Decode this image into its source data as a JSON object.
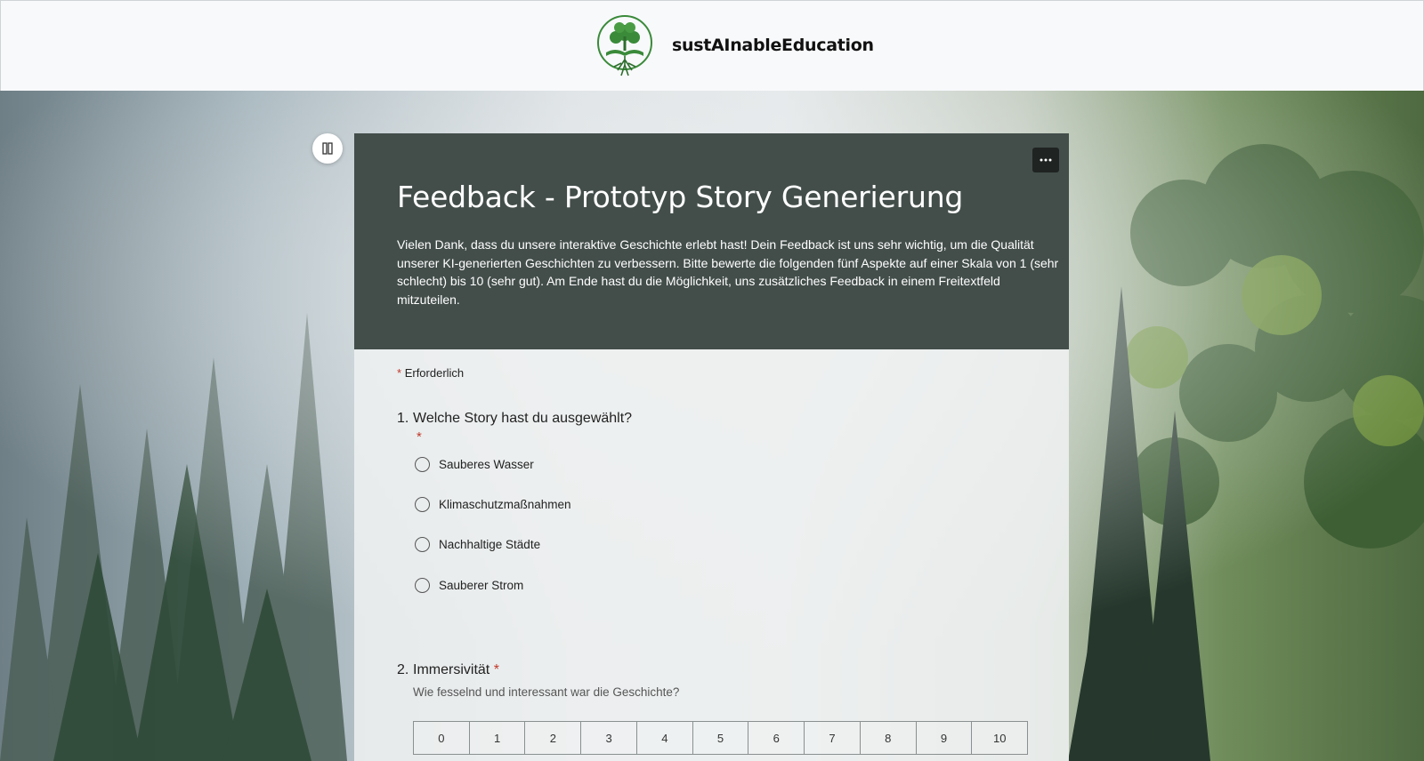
{
  "header": {
    "brand_name": "sustAInableEducation",
    "logo_icon": "tree-book-logo"
  },
  "colors": {
    "form_header_bg": "#434e4b",
    "required_star": "#c0392b",
    "brand_green": "#3a8a3a"
  },
  "controls": {
    "pause_icon": "pause-icon",
    "more_icon": "more-options-icon"
  },
  "form": {
    "title": "Feedback - Prototyp Story Generierung",
    "description": "Vielen Dank, dass du unsere interaktive Geschichte erlebt hast! Dein Feedback ist uns sehr wichtig, um die Qualität unserer KI-generierten Geschichten zu verbessern. Bitte bewerte die folgenden fünf Aspekte auf einer Skala von 1 (sehr schlecht) bis 10 (sehr gut). Am Ende hast du die Möglichkeit, uns zusätzliches Feedback in einem Freitextfeld mitzuteilen.",
    "required_star": "*",
    "required_label": "Erforderlich"
  },
  "questions": [
    {
      "number": "1.",
      "title": "Welche Story hast du ausgewählt?",
      "required": "*",
      "options": [
        "Sauberes Wasser",
        "Klimaschutzmaßnahmen",
        "Nachhaltige Städte",
        "Sauberer Strom"
      ]
    },
    {
      "number": "2.",
      "title": "Immersivität",
      "required": "*",
      "subtitle": "Wie fesselnd und interessant war die Geschichte?",
      "scale": [
        "0",
        "1",
        "2",
        "3",
        "4",
        "5",
        "6",
        "7",
        "8",
        "9",
        "10"
      ]
    }
  ]
}
